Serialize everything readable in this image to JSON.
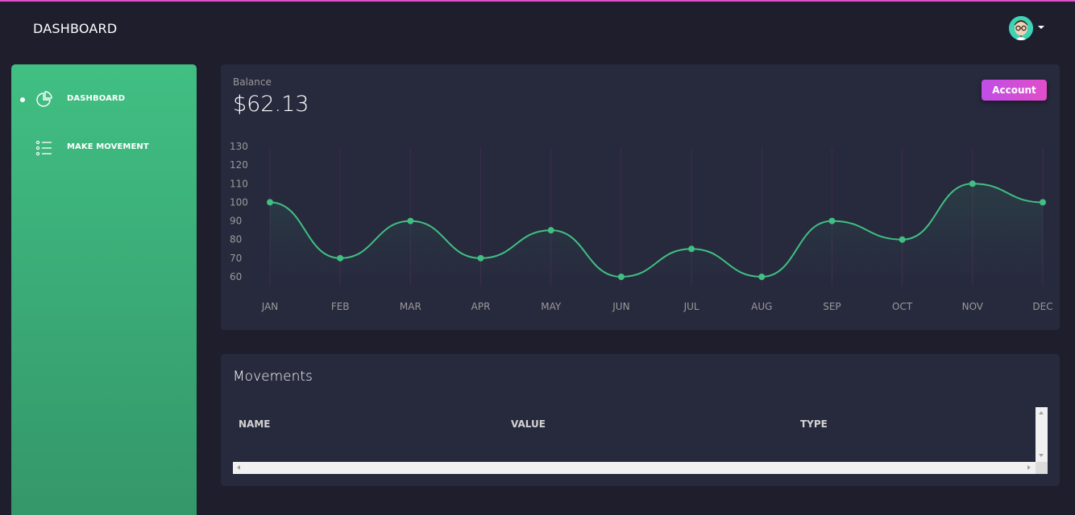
{
  "navbar": {
    "title": "DASHBOARD",
    "accent_color": "#e14eca"
  },
  "sidebar": {
    "gradient_top": "#41bf83",
    "gradient_bottom": "#34976a",
    "items": [
      {
        "label": "DASHBOARD",
        "icon": "pie-chart-icon",
        "active": true
      },
      {
        "label": "MAKE MOVEMENT",
        "icon": "list-icon",
        "active": false
      }
    ]
  },
  "balance": {
    "label": "Balance",
    "value": "$62.13",
    "account_button": "Account"
  },
  "chart_data": {
    "type": "line",
    "categories": [
      "JAN",
      "FEB",
      "MAR",
      "APR",
      "MAY",
      "JUN",
      "JUL",
      "AUG",
      "SEP",
      "OCT",
      "NOV",
      "DEC"
    ],
    "series": [
      {
        "values": [
          100,
          70,
          90,
          70,
          85,
          60,
          75,
          60,
          90,
          80,
          110,
          100
        ],
        "color": "#41bf83"
      }
    ],
    "y_ticks": [
      130,
      120,
      110,
      100,
      90,
      80,
      70,
      60
    ],
    "ylim": [
      60,
      130
    ],
    "grid": "vertical",
    "legend": "none"
  },
  "movements": {
    "title": "Movements",
    "columns": [
      "NAME",
      "VALUE",
      "TYPE"
    ]
  }
}
